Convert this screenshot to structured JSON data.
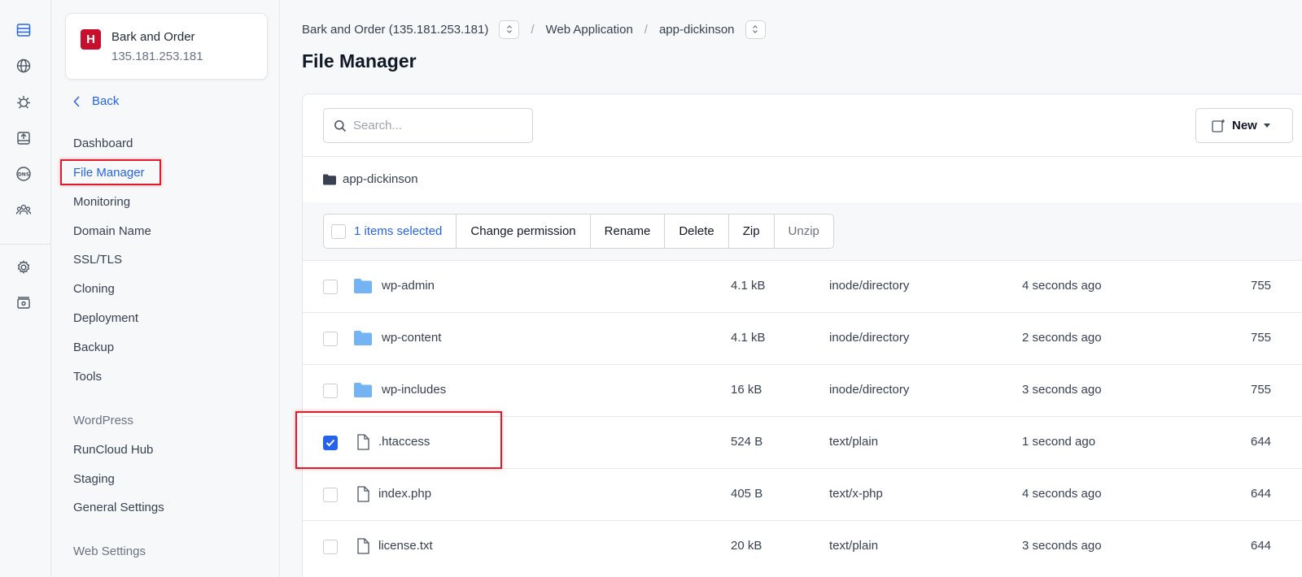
{
  "rail": {
    "top_icons": [
      "server-icon",
      "globe-icon",
      "bug-icon",
      "upload-icon",
      "dns-icon",
      "team-icon"
    ],
    "bottom_icons": [
      "settings-icon",
      "billing-icon"
    ],
    "dns_label": "DNS"
  },
  "server": {
    "logo_letter": "H",
    "name": "Bark and Order",
    "ip": "135.181.253.181",
    "logo_color": "#c8102e"
  },
  "sidebar": {
    "back_label": "Back",
    "items": [
      {
        "label": "Dashboard"
      },
      {
        "label": "File Manager",
        "active": true
      },
      {
        "label": "Monitoring"
      },
      {
        "label": "Domain Name"
      },
      {
        "label": "SSL/TLS"
      },
      {
        "label": "Cloning"
      },
      {
        "label": "Deployment"
      },
      {
        "label": "Backup"
      },
      {
        "label": "Tools"
      }
    ],
    "wordpress_section": "WordPress",
    "wordpress_items": [
      {
        "label": "RunCloud Hub"
      },
      {
        "label": "Staging"
      },
      {
        "label": "General Settings"
      }
    ],
    "web_settings_section": "Web Settings"
  },
  "breadcrumb": {
    "server": "Bark and Order (135.181.253.181)",
    "section": "Web Application",
    "app": "app-dickinson",
    "separator": "/"
  },
  "page_title": "File Manager",
  "search": {
    "placeholder": "Search...",
    "value": ""
  },
  "new_button_label": "New",
  "current_path": "app-dickinson",
  "toolbar": {
    "selected_label": "1 items selected",
    "change_permission": "Change permission",
    "rename": "Rename",
    "delete": "Delete",
    "zip": "Zip",
    "unzip": "Unzip"
  },
  "files": [
    {
      "name": "wp-admin",
      "kind": "folder",
      "size": "4.1 kB",
      "type": "inode/directory",
      "modified": "4 seconds ago",
      "perm": "755",
      "checked": false
    },
    {
      "name": "wp-content",
      "kind": "folder",
      "size": "4.1 kB",
      "type": "inode/directory",
      "modified": "2 seconds ago",
      "perm": "755",
      "checked": false
    },
    {
      "name": "wp-includes",
      "kind": "folder",
      "size": "16 kB",
      "type": "inode/directory",
      "modified": "3 seconds ago",
      "perm": "755",
      "checked": false
    },
    {
      "name": ".htaccess",
      "kind": "file",
      "size": "524 B",
      "type": "text/plain",
      "modified": "1 second ago",
      "perm": "644",
      "checked": true
    },
    {
      "name": "index.php",
      "kind": "file",
      "size": "405 B",
      "type": "text/x-php",
      "modified": "4 seconds ago",
      "perm": "644",
      "checked": false
    },
    {
      "name": "license.txt",
      "kind": "file",
      "size": "20 kB",
      "type": "text/plain",
      "modified": "3 seconds ago",
      "perm": "644",
      "checked": false
    }
  ],
  "colors": {
    "accent": "#2563eb",
    "highlight": "#e11d2a",
    "folder": "#74b4f5"
  }
}
